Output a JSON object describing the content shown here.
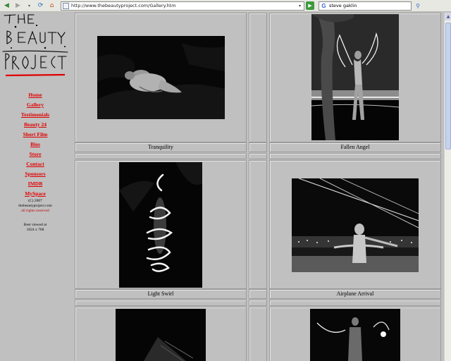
{
  "browser": {
    "url": "http://www.thebeautyproject.com/Gallery.htm",
    "search_value": "steve gaklin",
    "icons": [
      "back-icon",
      "forward-icon",
      "dropdown-icon",
      "refresh-icon",
      "home-icon",
      "go-icon",
      "google-icon",
      "search-icon"
    ]
  },
  "site": {
    "logo_text": "THE BEAUTY PROJECT",
    "nav": [
      {
        "label": "Home"
      },
      {
        "label": "Gallery"
      },
      {
        "label": "Testimonials"
      },
      {
        "label": "Beauty 24"
      },
      {
        "label": "Short Film"
      },
      {
        "label": "Bios"
      },
      {
        "label": "Store"
      },
      {
        "label": "Contact"
      },
      {
        "label": "Sponsors"
      },
      {
        "label": "IMDB"
      },
      {
        "label": "MySpace"
      }
    ],
    "copyright_line1": "(C) 2007",
    "copyright_line2": "thebeautyproject.com",
    "copyright_line3": "all rights reserved",
    "best_viewed_line1": "Best viewed at",
    "best_viewed_line2": "1024 x 768"
  },
  "gallery": {
    "captions": [
      "Tranquility",
      "Fallen Angel",
      "Light Swirl",
      "Airplane Arrival"
    ]
  },
  "colors": {
    "page_bg": "#c0c0c0",
    "nav_link": "#e00000",
    "logo_underline": "#e00000"
  }
}
